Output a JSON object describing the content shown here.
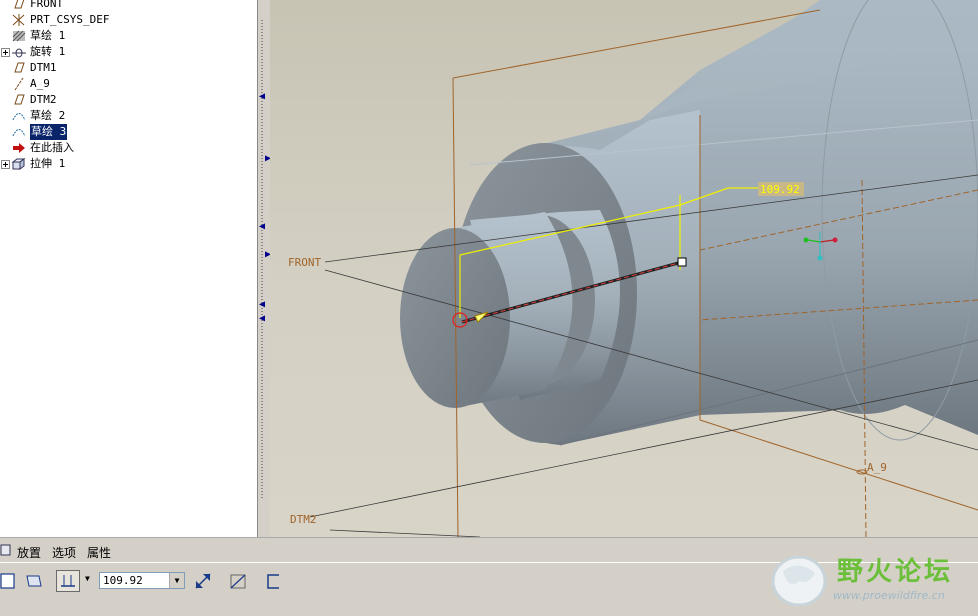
{
  "model_tree": {
    "items": [
      {
        "label": "FRONT",
        "icon": "datum-plane-icon",
        "expandable": false,
        "selected": false
      },
      {
        "label": "PRT_CSYS_DEF",
        "icon": "coordinate-system-icon",
        "expandable": false,
        "selected": false
      },
      {
        "label": "草绘 1",
        "icon": "sketch-hatched-icon",
        "expandable": false,
        "selected": false
      },
      {
        "label": "旋转 1",
        "icon": "revolve-icon",
        "expandable": true,
        "selected": false
      },
      {
        "label": "DTM1",
        "icon": "datum-plane-icon",
        "expandable": false,
        "selected": false
      },
      {
        "label": "A_9",
        "icon": "datum-axis-icon",
        "expandable": false,
        "selected": false
      },
      {
        "label": "DTM2",
        "icon": "datum-plane-icon",
        "expandable": false,
        "selected": false
      },
      {
        "label": "草绘 2",
        "icon": "sketch-icon",
        "expandable": false,
        "selected": false
      },
      {
        "label": "草绘 3",
        "icon": "sketch-icon",
        "expandable": false,
        "selected": true
      },
      {
        "label": "在此插入",
        "icon": "insert-here-arrow-icon",
        "expandable": false,
        "selected": false
      },
      {
        "label": "拉伸 1",
        "icon": "extrude-icon",
        "expandable": true,
        "selected": false
      }
    ]
  },
  "viewport": {
    "labels": {
      "front": "FRONT",
      "dtm2": "DTM2",
      "axis": "A_9",
      "dimension": "109.92"
    },
    "colors": {
      "datum_plane": "#a0642a",
      "dimension": "#ffff00",
      "dimension_tag_bg": "#d8c890",
      "body": "#8e9aa4"
    }
  },
  "dashboard": {
    "tabs": [
      "放置",
      "选项",
      "属性"
    ],
    "depth_value": "109.92",
    "icons": [
      "solid-icon",
      "surface-icon",
      "blind-depth-icon",
      "flip-direction-icon",
      "remove-material-icon",
      "thicken-icon"
    ]
  },
  "watermark": {
    "text": "野火论坛",
    "url": "www.proewildfire.cn"
  }
}
